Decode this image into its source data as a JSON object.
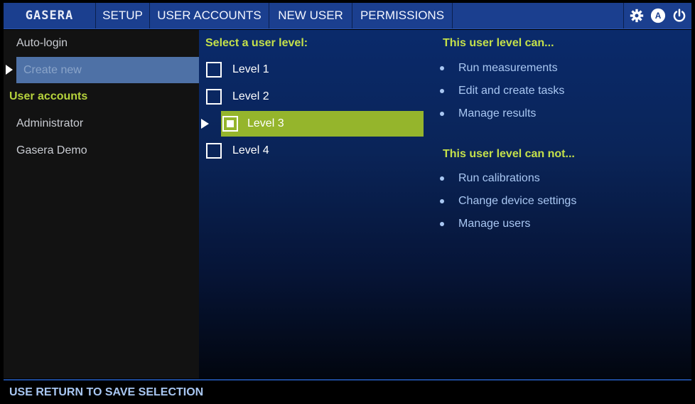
{
  "header": {
    "brand": "GASERA",
    "tabs": [
      "SETUP",
      "USER ACCOUNTS",
      "NEW USER",
      "PERMISSIONS"
    ],
    "icons": [
      "gear-icon",
      "account-icon",
      "power-icon"
    ],
    "account_badge": "A"
  },
  "sidebar": {
    "autologin": "Auto-login",
    "create_new": "Create new",
    "accounts_heading": "User accounts",
    "accounts": [
      "Administrator",
      "Gasera Demo"
    ]
  },
  "levels": {
    "heading": "Select a user level:",
    "items": [
      "Level 1",
      "Level 2",
      "Level 3",
      "Level 4"
    ],
    "selected": "Level 3"
  },
  "permissions": {
    "can_heading": "This user level can...",
    "can": [
      "Run measurements",
      "Edit and create tasks",
      "Manage results"
    ],
    "cannot_heading": "This user level can not...",
    "cannot": [
      "Run calibrations",
      "Change device settings",
      "Manage users"
    ]
  },
  "footer": {
    "status": "USE RETURN TO SAVE SELECTION"
  },
  "colors": {
    "accent_green": "#95b52c",
    "heading_green": "#c4e04a",
    "topbar_blue": "#1b3f8f",
    "text_blue": "#a9c7f2"
  }
}
